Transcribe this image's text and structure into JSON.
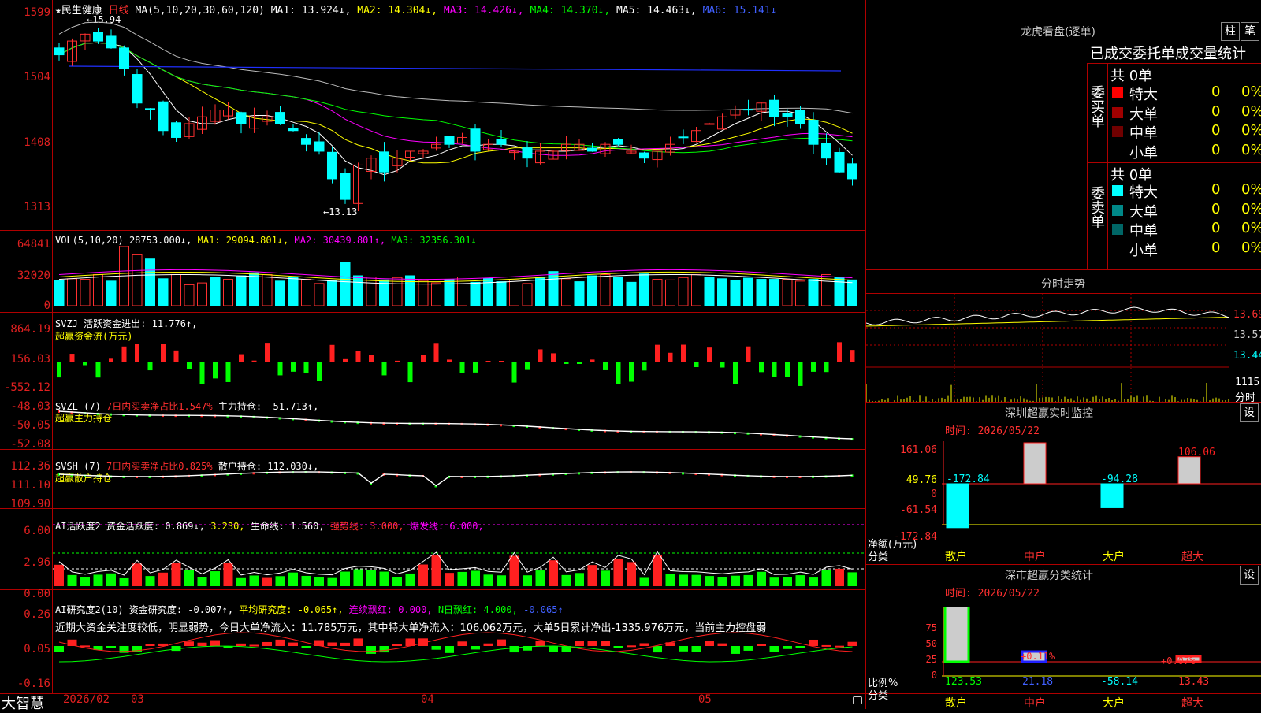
{
  "stock": {
    "name": "★民生健康",
    "period": "日线",
    "ma_label": "MA(5,10,20,30,60,120)",
    "ma1": "MA1: 13.924↓,",
    "ma2": "MA2: 14.304↓,",
    "ma3": "MA3: 14.426↓,",
    "ma4": "MA4: 14.370↓,",
    "ma5": "MA5: 14.463↓,",
    "ma6": "MA6: 15.141↓",
    "high_mark": "15.94",
    "low_mark": "←13.13",
    "y_ticks": [
      "1599",
      "1504",
      "1408",
      "1313"
    ]
  },
  "volume": {
    "label": "VOL(5,10,20)",
    "value": "28753.000↓,",
    "ma1": "MA1: 29094.801↓,",
    "ma2": "MA2: 30439.801↑,",
    "ma3": "MA3: 32356.301↓",
    "y_ticks": [
      "64841",
      "32020",
      "0"
    ],
    "bars": [
      0.42,
      0.45,
      0.44,
      0.52,
      0.41,
      1.0,
      0.85,
      0.78,
      0.45,
      0.52,
      0.35,
      0.38,
      0.48,
      0.44,
      0.5,
      0.55,
      0.52,
      0.41,
      0.48,
      0.44,
      0.37,
      0.42,
      0.72,
      0.5,
      0.48,
      0.43,
      0.47,
      0.5,
      0.42,
      0.38,
      0.44,
      0.48,
      0.39,
      0.46,
      0.4,
      0.43,
      0.37,
      0.48,
      0.57,
      0.45,
      0.4,
      0.5,
      0.52,
      0.48,
      0.39,
      0.53,
      0.44,
      0.43,
      0.47,
      0.52,
      0.47,
      0.45,
      0.42,
      0.46,
      0.44,
      0.44,
      0.44,
      0.41,
      0.44,
      0.52,
      0.48,
      0.43
    ]
  },
  "svzj": {
    "label": "SVZJ",
    "text": "活跃资金进出: 11.776↑,",
    "sub": "超赢资金流(万元)",
    "y_ticks": [
      "864.19",
      "156.03",
      "-552.12"
    ]
  },
  "svzl": {
    "label": "SVZL (7)",
    "text1": "7日内买卖净占比1.547%",
    "text2": "主力持仓: -51.713↑,",
    "sub": "超赢主力持仓",
    "y_ticks": [
      "-48.03",
      "-50.05",
      "-52.08"
    ]
  },
  "svsh": {
    "label": "SVSH (7)",
    "text1": "7日内买卖净占比0.825%",
    "text2": "散户持仓: 112.030↓,",
    "sub": "超赢散户持仓",
    "y_ticks": [
      "112.36",
      "111.10",
      "109.90"
    ]
  },
  "ai_active": {
    "label": "AI活跃度2",
    "t1": "资金活跃度: 0.869↓,",
    "t2": "3.230,",
    "t3": "生命线: 1.560,",
    "t4": "强势线: 3.000,",
    "t5": "爆发线: 6.000,",
    "y_ticks": [
      "6.00",
      "2.96",
      "0.00"
    ]
  },
  "ai_research": {
    "label": "AI研究度2(10)",
    "t1": "资金研究度: -0.007↑,",
    "t2": "平均研究度: -0.065↑,",
    "t3": "连续飘红: 0.000,",
    "t4": "N日飘红: 4.000,",
    "t5": "-0.065↑",
    "note": "近期大资金关注度较低，明显弱势，今日大单净流入：11.785万元，其中特大单净流入：106.062万元，大单5日累计净出-1335.976万元，当前主力控盘弱",
    "y_ticks": [
      "0.26",
      "0.05",
      "-0.16"
    ]
  },
  "bottom": {
    "brand": "大智慧",
    "dates": [
      "2026/02",
      "03",
      "04",
      "05"
    ]
  },
  "longhu": {
    "title": "龙虎看盘(逐单)",
    "btn_bar": "柱",
    "btn_pen": "笔",
    "tabs": "已成交委托单成交量统计",
    "buy_side": "委买单",
    "sell_side": "委卖单",
    "buy_total": "共 0单",
    "sell_total": "共 0单",
    "buy_rows": [
      {
        "label": "特大",
        "count": "0",
        "pct": "0%",
        "color": "#ff0000"
      },
      {
        "label": "大单",
        "count": "0",
        "pct": "0%",
        "color": "#a00000"
      },
      {
        "label": "中单",
        "count": "0",
        "pct": "0%",
        "color": "#700000"
      },
      {
        "label": "小单",
        "count": "0",
        "pct": "0%",
        "color": ""
      }
    ],
    "sell_rows": [
      {
        "label": "特大",
        "count": "0",
        "pct": "0%",
        "color": "#00ffff"
      },
      {
        "label": "大单",
        "count": "0",
        "pct": "0%",
        "color": "#008888"
      },
      {
        "label": "中单",
        "count": "0",
        "pct": "0%",
        "color": "#006666"
      },
      {
        "label": "小单",
        "count": "0",
        "pct": "0%",
        "color": ""
      }
    ]
  },
  "intraday": {
    "title": "分时走势",
    "prices": [
      "13.69",
      "13.57",
      "13.44"
    ],
    "vol_label": "1115",
    "vol_sub": "分时"
  },
  "sz_monitor": {
    "title": "深圳超赢实时监控",
    "btn": "设",
    "time": "时间: 2026/05/22",
    "y_ticks": [
      "161.06",
      "49.76",
      "0",
      "-61.54",
      "-172.84"
    ],
    "axis_label": "净额(万元)",
    "axis_sub": "分类",
    "categories": [
      "散户",
      "中户",
      "大户",
      "超大"
    ],
    "values": [
      "-172.84",
      "161.06",
      "-94.28",
      "106.06"
    ]
  },
  "sz_class": {
    "title": "深市超赢分类统计",
    "btn": "设",
    "time": "时间: 2026/05/22",
    "y_ticks": [
      "75",
      "50",
      "25",
      "0"
    ],
    "axis_label": "比例%",
    "axis_sub": "分类",
    "categories": [
      "散户",
      "中户",
      "大户",
      "超大"
    ],
    "values": [
      "123.53",
      "21.18",
      "-58.14",
      "13.43"
    ],
    "pct_labels": [
      "+0.11%",
      "+0.07%"
    ]
  }
}
